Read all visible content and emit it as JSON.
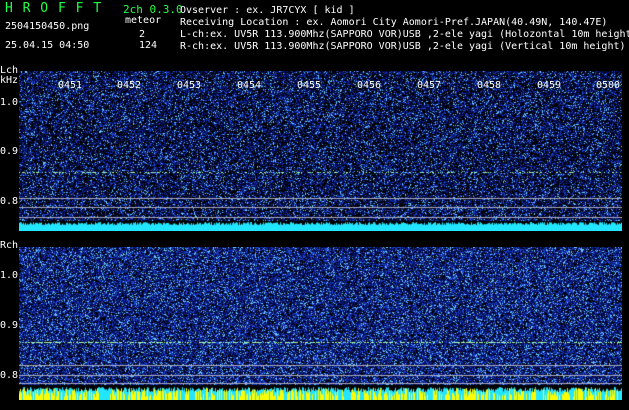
{
  "app": {
    "title": "H R O F F T",
    "filename": "2504150450.png",
    "datetime": "25.04.15 04:50",
    "channel_mode": "2ch 0.3.0",
    "meteor_label": "meteor",
    "meteor_count_l": "2",
    "meteor_count_r": "124"
  },
  "info": {
    "observer": "Ovserver              : ex. JR7CYX [ kid ]",
    "location": "Receiving Location : ex. Aomori City Aomori-Pref.JAPAN(40.49N, 140.47E)",
    "lch": "L-ch:ex. UV5R 113.900Mhz(SAPPORO VOR)USB ,2-ele yagi (Holozontal 10m height",
    "rch": "R-ch:ex. UV5R 113.900Mhz(SAPPORO VOR)USB ,2-ele yagi (Vertical 10m height)"
  },
  "lch_panel": {
    "label": "Lch",
    "unit": "kHz",
    "yticks": [
      "1.0",
      "0.9",
      "0.8"
    ],
    "time_ticks": [
      "0451",
      "0452",
      "0453",
      "0454",
      "0455",
      "0456",
      "0457",
      "0458",
      "0459",
      "0500"
    ]
  },
  "rch_panel": {
    "label": "Rch",
    "yticks": [
      "1.0",
      "0.9",
      "0.8"
    ]
  },
  "colors": {
    "background": "#000000",
    "noise_dark": "#0a1a6e",
    "noise_mid": "#2a55d6",
    "noise_bright": "#7fd0ff",
    "meteor_line": "#aaffaa",
    "level_cyan": "#22e5ff",
    "level_yellow": "#ffff00",
    "text_green": "#22ff44"
  }
}
